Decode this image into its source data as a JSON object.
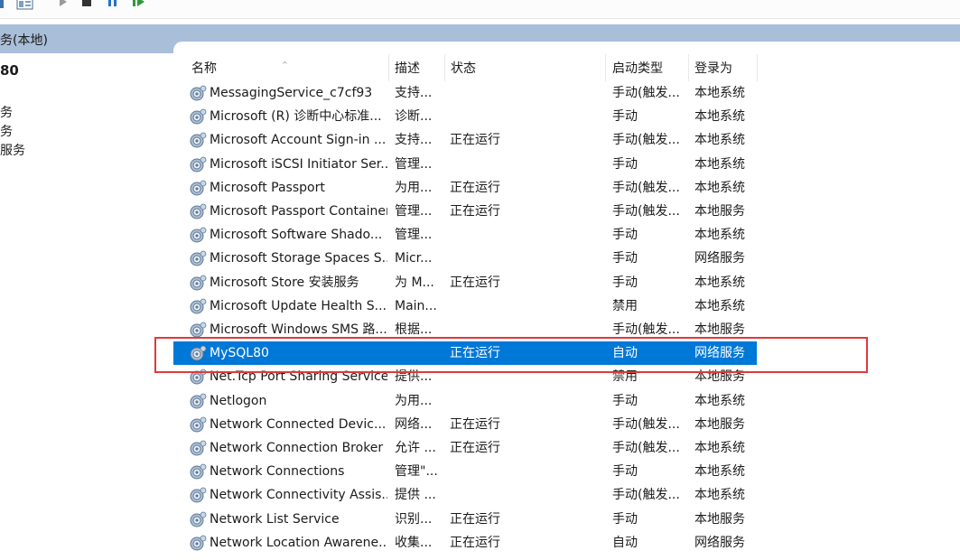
{
  "toolbar": {
    "buttons": [
      {
        "icon": "help-icon"
      },
      {
        "icon": "properties-pane-icon"
      },
      {
        "icon": "play-icon"
      },
      {
        "icon": "stop-icon"
      },
      {
        "icon": "pause-icon"
      },
      {
        "icon": "resume-icon"
      }
    ]
  },
  "scope": {
    "title": "务(本地)"
  },
  "left_pane": {
    "service_name": "80",
    "links": [
      "务",
      "务",
      "服务"
    ]
  },
  "columns": {
    "name": "名称",
    "description": "描述",
    "status": "状态",
    "startup_type": "启动类型",
    "logon_as": "登录为"
  },
  "services": [
    {
      "name": "MessagingService_c7cf93",
      "description": "支持...",
      "status": "",
      "startup_type": "手动(触发...",
      "logon_as": "本地系统"
    },
    {
      "name": "Microsoft (R) 诊断中心标准...",
      "description": "诊断...",
      "status": "",
      "startup_type": "手动",
      "logon_as": "本地系统"
    },
    {
      "name": "Microsoft Account Sign-in ...",
      "description": "支持...",
      "status": "正在运行",
      "startup_type": "手动(触发...",
      "logon_as": "本地系统"
    },
    {
      "name": "Microsoft iSCSI Initiator Ser...",
      "description": "管理...",
      "status": "",
      "startup_type": "手动",
      "logon_as": "本地系统"
    },
    {
      "name": "Microsoft Passport",
      "description": "为用...",
      "status": "正在运行",
      "startup_type": "手动(触发...",
      "logon_as": "本地系统"
    },
    {
      "name": "Microsoft Passport Container",
      "description": "管理...",
      "status": "正在运行",
      "startup_type": "手动(触发...",
      "logon_as": "本地服务"
    },
    {
      "name": "Microsoft Software Shado...",
      "description": "管理...",
      "status": "",
      "startup_type": "手动",
      "logon_as": "本地系统"
    },
    {
      "name": "Microsoft Storage Spaces S...",
      "description": "Micr...",
      "status": "",
      "startup_type": "手动",
      "logon_as": "网络服务"
    },
    {
      "name": "Microsoft Store 安装服务",
      "description": "为 M...",
      "status": "正在运行",
      "startup_type": "手动",
      "logon_as": "本地系统"
    },
    {
      "name": "Microsoft Update Health S...",
      "description": "Main...",
      "status": "",
      "startup_type": "禁用",
      "logon_as": "本地系统"
    },
    {
      "name": "Microsoft Windows SMS 路...",
      "description": "根据...",
      "status": "",
      "startup_type": "手动(触发...",
      "logon_as": "本地服务"
    },
    {
      "name": "MySQL80",
      "description": "",
      "status": "正在运行",
      "startup_type": "自动",
      "logon_as": "网络服务",
      "selected": true
    },
    {
      "name": "Net.Tcp Port Sharing Service",
      "description": "提供...",
      "status": "",
      "startup_type": "禁用",
      "logon_as": "本地服务"
    },
    {
      "name": "Netlogon",
      "description": "为用...",
      "status": "",
      "startup_type": "手动",
      "logon_as": "本地系统"
    },
    {
      "name": "Network Connected Devic...",
      "description": "网络...",
      "status": "正在运行",
      "startup_type": "手动(触发...",
      "logon_as": "本地服务"
    },
    {
      "name": "Network Connection Broker",
      "description": "允许 ...",
      "status": "正在运行",
      "startup_type": "手动(触发...",
      "logon_as": "本地系统"
    },
    {
      "name": "Network Connections",
      "description": "管理\"...",
      "status": "",
      "startup_type": "手动",
      "logon_as": "本地系统"
    },
    {
      "name": "Network Connectivity Assis...",
      "description": "提供 ...",
      "status": "",
      "startup_type": "手动(触发...",
      "logon_as": "本地系统"
    },
    {
      "name": "Network List Service",
      "description": "识别...",
      "status": "正在运行",
      "startup_type": "手动",
      "logon_as": "本地服务"
    },
    {
      "name": "Network Location Awarene...",
      "description": "收集...",
      "status": "正在运行",
      "startup_type": "自动",
      "logon_as": "网络服务"
    }
  ],
  "colors": {
    "selection": "#0078d7",
    "scope_bar": "#a9bed8",
    "highlight_box": "#e03a3a"
  }
}
